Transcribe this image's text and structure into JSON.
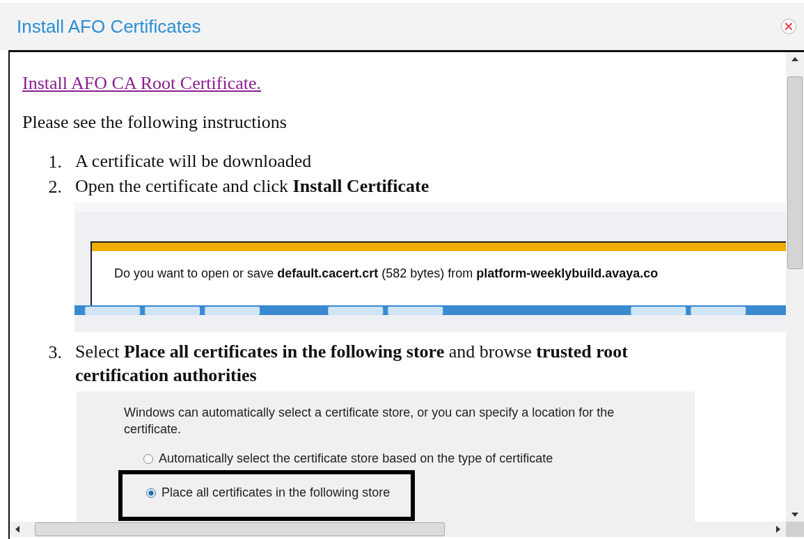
{
  "window": {
    "title": "Install AFO Certificates"
  },
  "link": "Install AFO CA Root Certificate.",
  "intro": "Please see the following instructions",
  "steps": [
    {
      "number": "1.",
      "text": "A certificate will be downloaded"
    },
    {
      "number": "2.",
      "text": "Open the certificate and click **Install Certificate**",
      "screenshot": {
        "kind": "download-bar",
        "message": "Do you want to open or save **default.cacert.crt** (582 bytes) from **platform-weeklybuild.avaya.co**"
      }
    },
    {
      "number": "3.",
      "text": "Select **Place all certificates in the following store** and browse **trusted root certification authorities**",
      "screenshot": {
        "kind": "store-dialog",
        "description": "Windows can automatically select a certificate store, or you can specify a location for the certificate.",
        "options": [
          {
            "label": "Automatically select the certificate store based on the type of certificate",
            "selected": false,
            "highlighted": false
          },
          {
            "label": "Place all certificates in the following store",
            "selected": true,
            "highlighted": true
          }
        ]
      }
    }
  ]
}
